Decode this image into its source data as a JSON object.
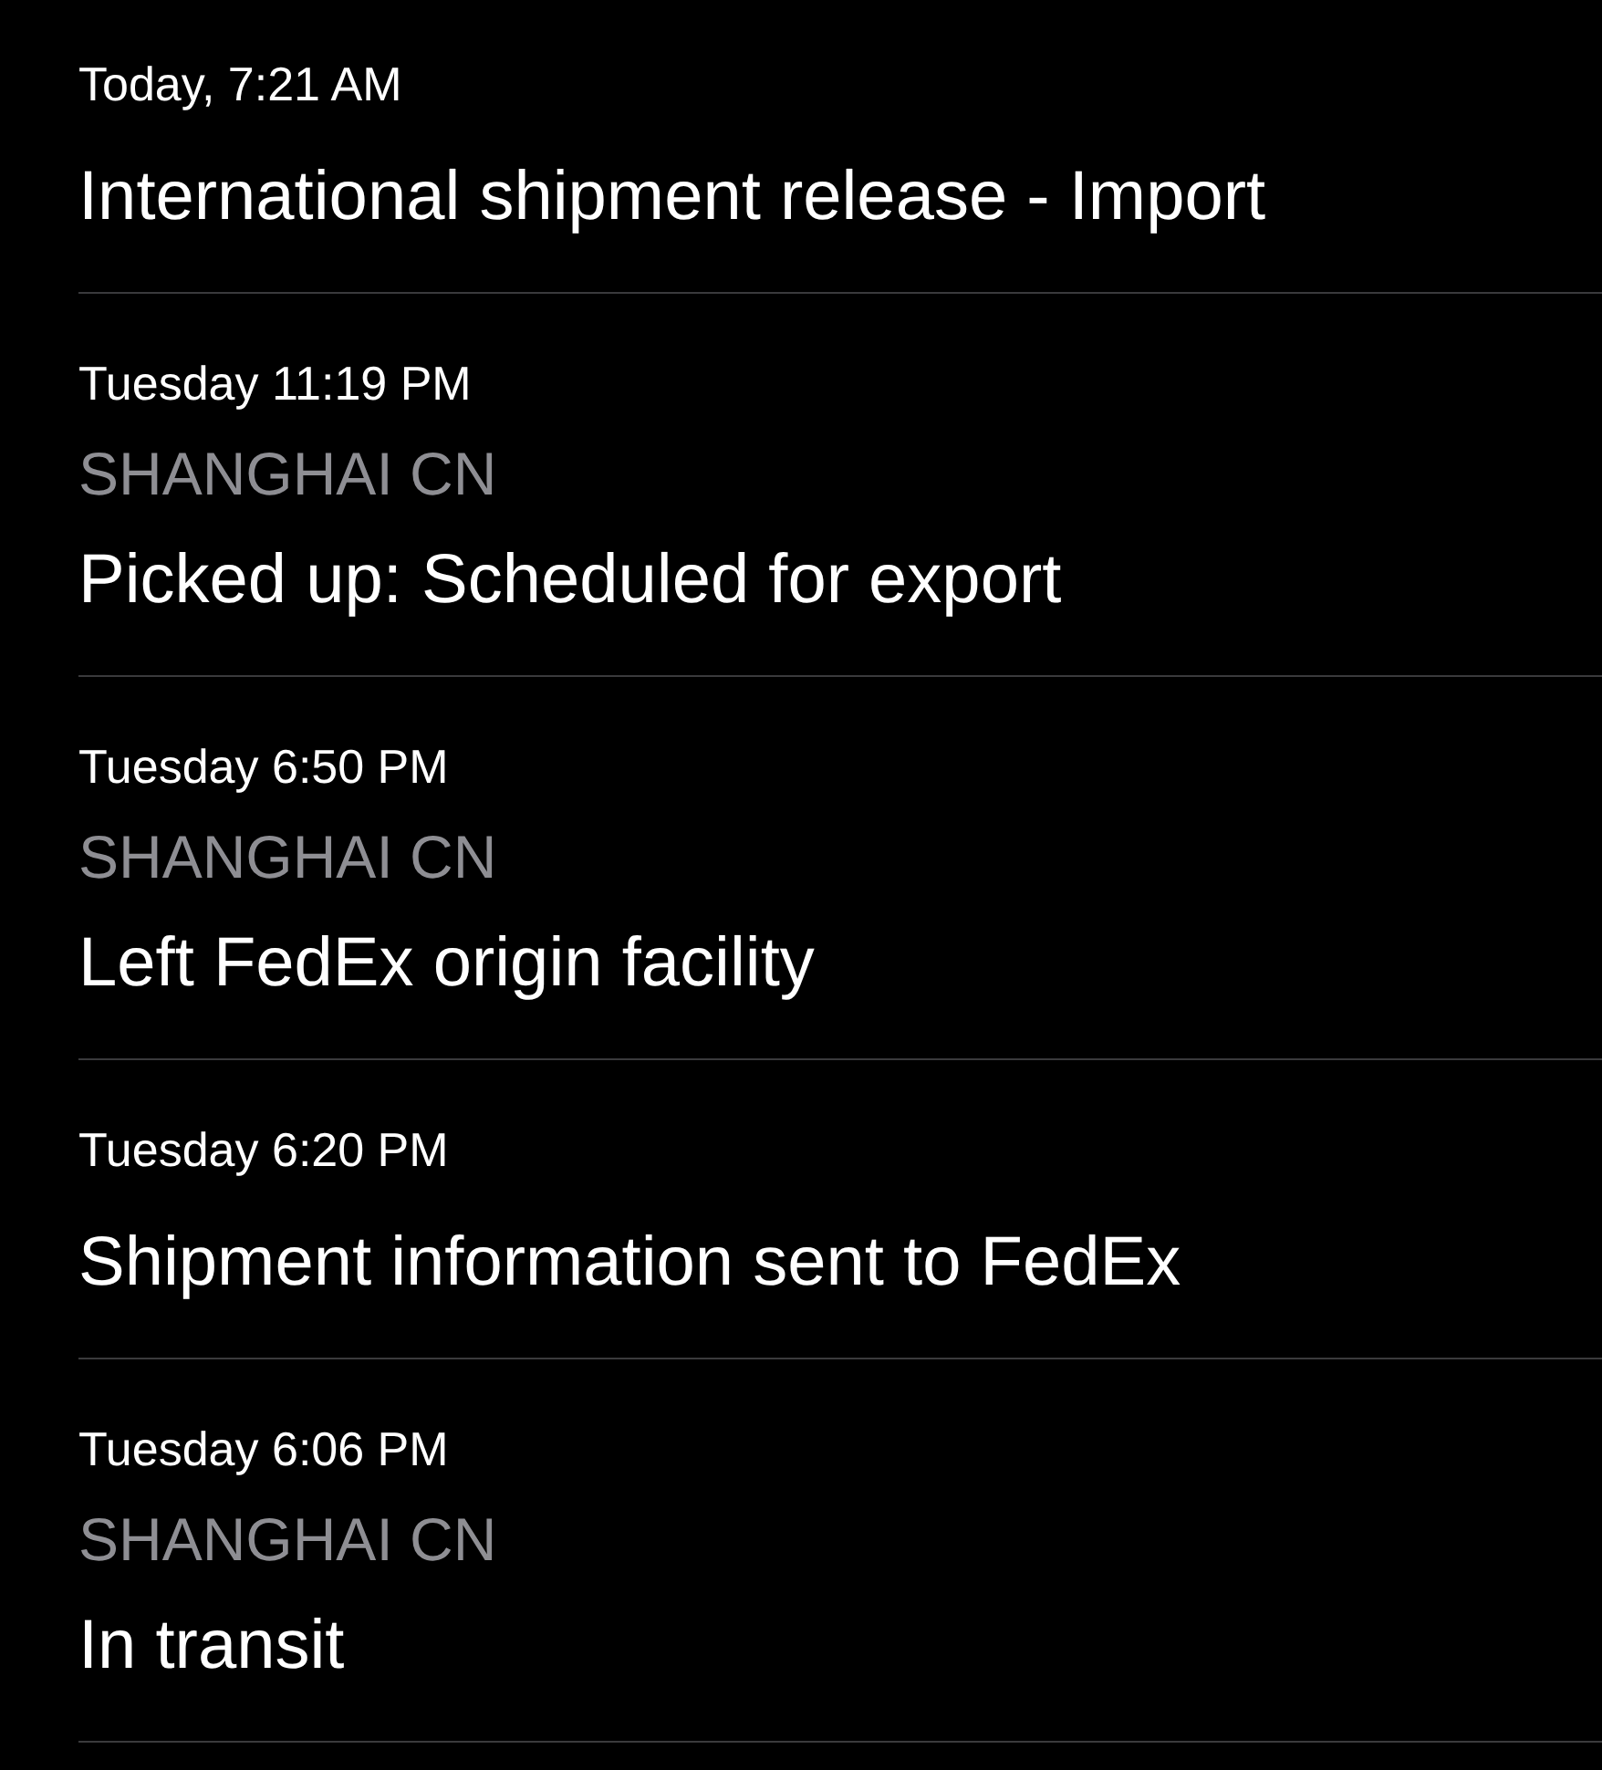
{
  "events": [
    {
      "time": "Today, 7:21 AM",
      "title": "International shipment release - Import"
    },
    {
      "time": "Tuesday 11:19 PM",
      "location": "SHANGHAI CN",
      "title": "Picked up: Scheduled for export"
    },
    {
      "time": "Tuesday 6:50 PM",
      "location": "SHANGHAI CN",
      "title": "Left FedEx origin facility"
    },
    {
      "time": "Tuesday 6:20 PM",
      "title": "Shipment information sent to FedEx"
    },
    {
      "time": "Tuesday 6:06 PM",
      "location": "SHANGHAI CN",
      "title": "In transit"
    }
  ]
}
